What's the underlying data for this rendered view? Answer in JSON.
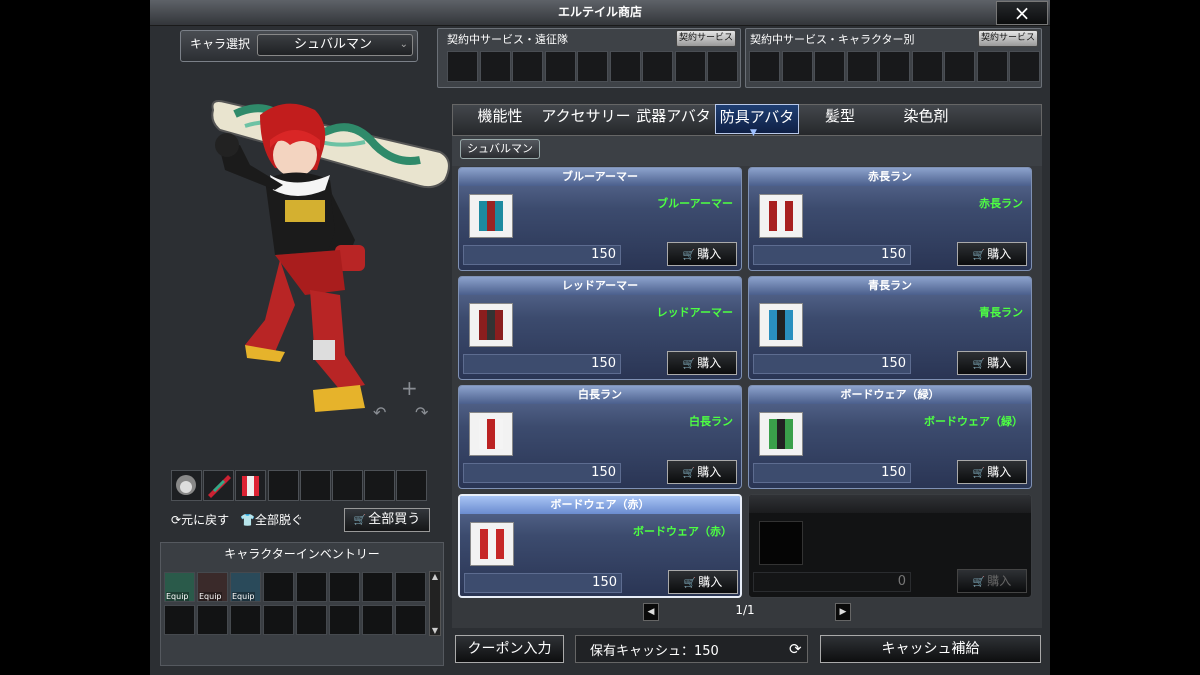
{
  "window": {
    "title": "エルテイル商店",
    "close_icon": "×"
  },
  "char_select": {
    "label": "キャラ選択",
    "value": "シュバルマン"
  },
  "preview": {
    "plus": "+",
    "minus": "−"
  },
  "actions": {
    "reset_label": "元に戻す",
    "undress_label": "全部脱ぐ",
    "buy_all_label": "全部買う"
  },
  "inventory": {
    "title": "キャラクターインベントリー",
    "equip_tag": "Equip"
  },
  "contracts": {
    "expedition_title": "契約中サービス・遠征隊",
    "character_title": "契約中サービス・キャラクター別",
    "button_label": "契約サービス"
  },
  "tabs": [
    "機能性",
    "アクセサリー",
    "武器アバター",
    "防具アバター",
    "髪型",
    "染色剤"
  ],
  "active_tab": 3,
  "filter": "シュバルマン",
  "cards": [
    {
      "title": "ブルーアーマー",
      "name": "ブルーアーマー",
      "price": "150",
      "buy": "購入"
    },
    {
      "title": "赤長ラン",
      "name": "赤長ラン",
      "price": "150",
      "buy": "購入"
    },
    {
      "title": "レッドアーマー",
      "name": "レッドアーマー",
      "price": "150",
      "buy": "購入"
    },
    {
      "title": "青長ラン",
      "name": "青長ラン",
      "price": "150",
      "buy": "購入"
    },
    {
      "title": "白長ラン",
      "name": "白長ラン",
      "price": "150",
      "buy": "購入"
    },
    {
      "title": "ボードウェア（緑）",
      "name": "ボードウェア（緑）",
      "price": "150",
      "buy": "購入"
    },
    {
      "title": "ボードウェア（赤）",
      "name": "ボードウェア（赤）",
      "price": "150",
      "buy": "購入"
    },
    {
      "title": "",
      "name": "",
      "price": "0",
      "buy": "購入"
    }
  ],
  "pager": {
    "text": "1/1"
  },
  "bottom": {
    "coupon_label": "クーポン入力",
    "cash_label": "保有キャッシュ：150",
    "topup_label": "キャッシュ補給"
  },
  "colors": {
    "item_name": "#4dff42",
    "card_blue": "#3c4b6e",
    "tab_active": "#1f3f73"
  }
}
